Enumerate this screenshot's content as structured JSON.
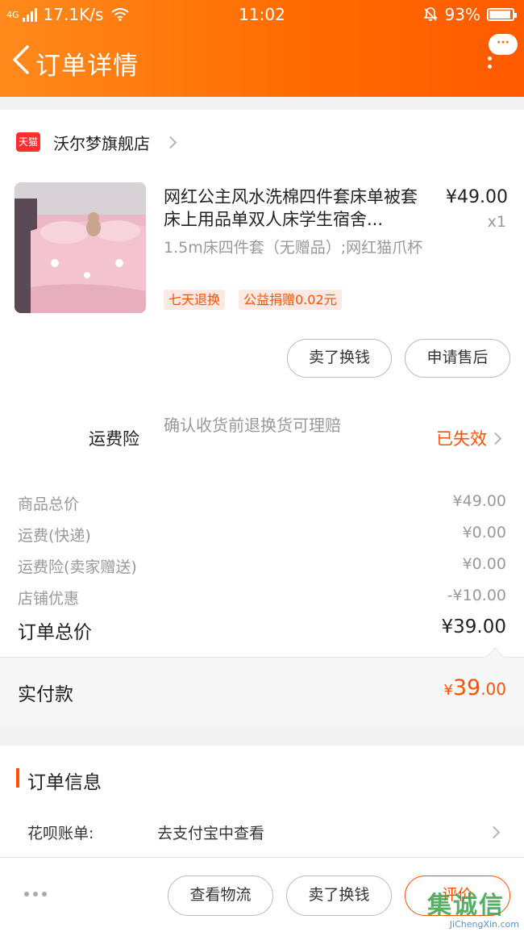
{
  "status_bar": {
    "network": "4G",
    "speed": "17.1K/s",
    "time": "11:02",
    "battery": "93%",
    "battery_level": 0.93
  },
  "nav": {
    "title": "订单详情",
    "more_bubble": "···"
  },
  "shop": {
    "badge": "天猫",
    "name": "沃尔梦旗舰店"
  },
  "product": {
    "title": "网红公主风水洗棉四件套床单被套床上用品单双人床学生宿舍...",
    "price": "¥49.00",
    "qty": "x1",
    "spec": "1.5m床四件套（无赠品）;网红猫爪杯",
    "tags": [
      "七天退换",
      "公益捐赠0.02元"
    ]
  },
  "actions": {
    "sell": "卖了换钱",
    "aftersale": "申请售后"
  },
  "insurance": {
    "label": "运费险",
    "desc": "确认收货前退换货可理赔",
    "status": "已失效"
  },
  "fees": [
    {
      "label": "商品总价",
      "value": "¥49.00"
    },
    {
      "label": "运费(快递)",
      "value": "¥0.00"
    },
    {
      "label": "运费险(卖家赠送)",
      "value": "¥0.00"
    },
    {
      "label": "店铺优惠",
      "value": "-¥10.00"
    }
  ],
  "total": {
    "label": "订单总价",
    "value": "¥39.00"
  },
  "paid": {
    "label": "实付款",
    "currency": "¥",
    "integer": "39",
    "decimal": ".00"
  },
  "order_info": {
    "title": "订单信息",
    "huabei_label": "花呗账单:",
    "huabei_value": "去支付宝中查看"
  },
  "bottom_bar": {
    "logistics": "查看物流",
    "sell": "卖了换钱",
    "review": "评价"
  },
  "watermark": {
    "main": "集诚信",
    "sub": "JiChengXin.com"
  }
}
